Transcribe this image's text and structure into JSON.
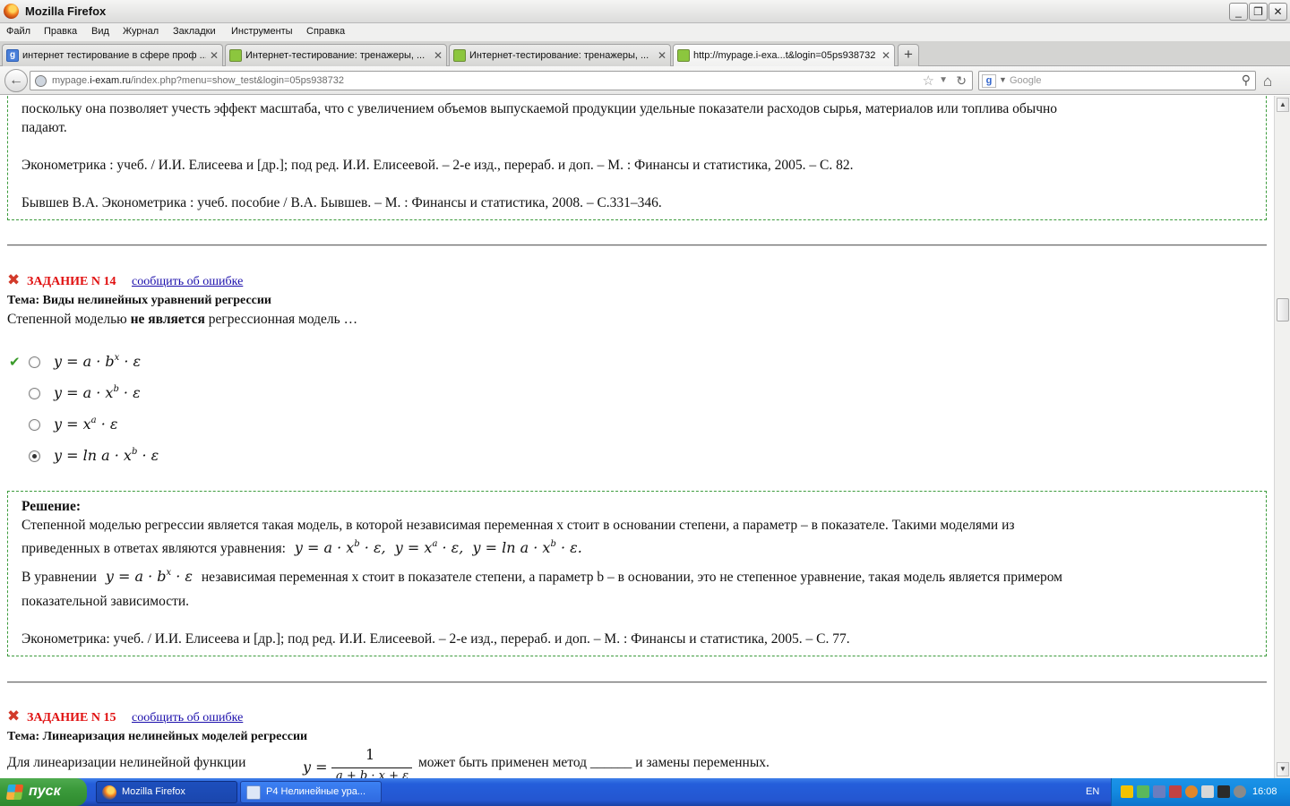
{
  "window": {
    "title": "Mozilla Firefox",
    "minimize": "_",
    "maximize": "❐",
    "close": "✕"
  },
  "menu": [
    "Файл",
    "Правка",
    "Вид",
    "Журнал",
    "Закладки",
    "Инструменты",
    "Справка"
  ],
  "tabs": [
    {
      "label": "интернет тестирование в сфере проф ..."
    },
    {
      "label": "Интернет-тестирование: тренажеры, ..."
    },
    {
      "label": "Интернет-тестирование: тренажеры, ..."
    },
    {
      "label": "http://mypage.i-exa...t&login=05ps938732"
    }
  ],
  "nav": {
    "url_prefix": "mypage.",
    "url_domain": "i-exam.ru",
    "url_rest": "/index.php?menu=show_test&login=05ps938732",
    "search_placeholder": "Google"
  },
  "content": {
    "prev_box": {
      "line1": "поскольку она позволяет учесть эффект масштаба, что с увеличением объемов выпускаемой продукции удельные показатели расходов сырья, материалов или топлива обычно",
      "line2": "падают.",
      "ref1": "Эконометрика : учеб. / И.И. Елисеева и [др.]; под ред. И.И. Елисеевой. – 2-е изд., перераб. и доп. – М. : Финансы и статистика, 2005. – С. 82.",
      "ref2": "Бывшев В.А. Эконометрика : учеб. пособие / В.А. Бывшев. – М. : Финансы и статистика, 2008. – С.331–346."
    },
    "task14": {
      "title": "ЗАДАНИЕ N 14",
      "report": "сообщить об ошибке",
      "topic": "Тема: Виды нелинейных уравнений регрессии",
      "question_pre": "Степенной моделью",
      "question_bold": "не является",
      "question_post": "регрессионная модель …",
      "options": [
        {
          "lhs": "y = a · b",
          "sup": "x",
          "tail": " · ε"
        },
        {
          "lhs": "y = a · x",
          "sup": "b",
          "tail": " · ε"
        },
        {
          "lhs": "y = x",
          "sup": "a",
          "tail": " · ε"
        },
        {
          "lhs": "y = ln a · x",
          "sup": "b",
          "tail": " · ε"
        }
      ],
      "solution_title": "Решение:",
      "sol_line1": "Степенной моделью регрессии является такая модель, в которой независимая переменная x стоит в основании степени, а параметр – в показателе. Такими моделями из",
      "sol_line2": "приведенных в ответах являются уравнения:",
      "sol_eqs": "y = a · x",
      "sol_line3_pre": "В уравнении",
      "sol_line3_post": "независимая переменная x стоит в показателе степени, а параметр b – в основании, это не степенное уравнение, такая модель является примером",
      "sol_line4": "показательной зависимости.",
      "ref": "Эконометрика: учеб. / И.И. Елисеева и [др.]; под ред. И.И. Елисеевой. – 2-е изд., перераб. и доп. – М. : Финансы и статистика, 2005. – С. 77."
    },
    "task15": {
      "title": "ЗАДАНИЕ N 15",
      "report": "сообщить об ошибке",
      "topic": "Тема: Линеаризация нелинейных моделей регрессии",
      "question_pre": "Для линеаризации  нелинейной функции",
      "question_post": "может быть применен метод ______ и замены переменных."
    }
  },
  "taskbar": {
    "start": "пуск",
    "items": [
      "Mozilla Firefox",
      "P4 Нелинейные ура..."
    ],
    "lang": "EN",
    "time": "16:08"
  },
  "colors": {
    "task_title": "#e01010",
    "link": "#1a0dab",
    "box_border": "#3c9b3c"
  }
}
